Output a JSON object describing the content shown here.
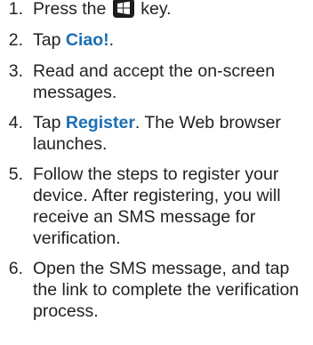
{
  "steps": [
    {
      "number": "1.",
      "before": "Press the",
      "icon": "windows-flag-icon",
      "after": "key."
    },
    {
      "number": "2.",
      "before": "Tap",
      "emphasis": "Ciao!",
      "after": "."
    },
    {
      "number": "3.",
      "text_lines": [
        "Read and accept the on-screen",
        "messages."
      ]
    },
    {
      "number": "4.",
      "before": "Tap",
      "emphasis": "Register",
      "after": ". The Web browser",
      "line2": "launches."
    },
    {
      "number": "5.",
      "text_lines": [
        "Follow the steps to register your",
        "device. After registering, you will",
        "receive an SMS message for",
        "verification."
      ]
    },
    {
      "number": "6.",
      "text_lines": [
        "Open the SMS message, and tap",
        "the link to complete the verification",
        "process."
      ]
    }
  ],
  "colors": {
    "text": "#222222",
    "accent": "#1a6fb5",
    "icon_bg": "#1d1d1d"
  }
}
